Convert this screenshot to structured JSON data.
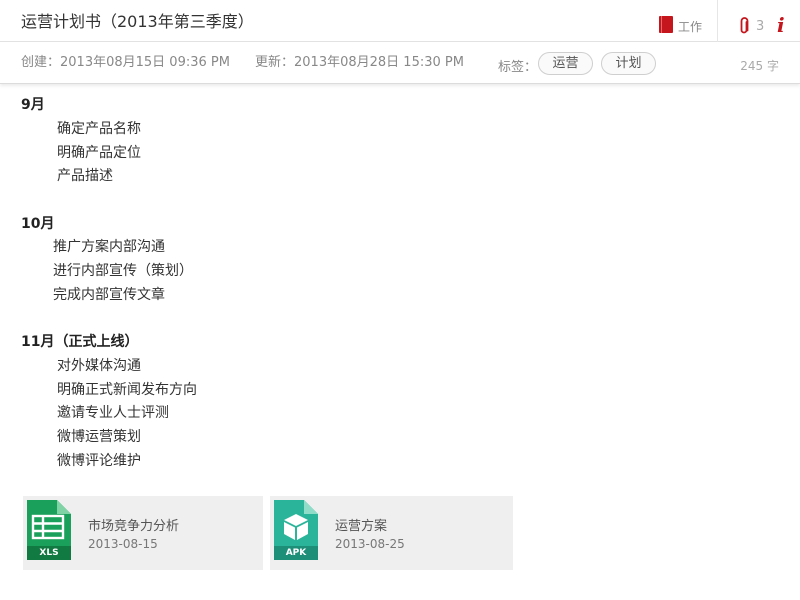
{
  "note": {
    "title": "运营计划书（2013年第三季度）",
    "notebook": "工作",
    "attachment_count": "3",
    "info_glyph": "i"
  },
  "meta": {
    "created": "创建：2013年08月15日  09:36 PM",
    "updated": "更新：2013年08月28日 15:30 PM",
    "tags_label": "标签：",
    "tags": [
      "运营",
      "计划"
    ],
    "word_count": "245 字"
  },
  "body": {
    "sections": [
      {
        "heading": "9月",
        "items": [
          "确定产品名称",
          "明确产品定位",
          "产品描述"
        ]
      },
      {
        "heading": "10月",
        "items": [
          "推广方案内部沟通",
          "进行内部宣传（策划）",
          "完成内部宣传文章"
        ]
      },
      {
        "heading": "11月（正式上线）",
        "items": [
          "对外媒体沟通",
          "明确正式新闻发布方向",
          "邀请专业人士评测",
          "微博运营策划",
          "微博评论维护"
        ]
      }
    ]
  },
  "attachments": [
    {
      "name": "市场竞争力分析",
      "date": "2013-08-15",
      "type": "XLS",
      "icon": "spreadsheet-icon",
      "color": "#1aa05a"
    },
    {
      "name": "运营方案",
      "date": "2013-08-25",
      "type": "APK",
      "icon": "package-icon",
      "color": "#2ab59a"
    }
  ],
  "colors": {
    "accent": "#c4161c",
    "xls": "#1aa05a",
    "apk": "#2ab59a"
  }
}
